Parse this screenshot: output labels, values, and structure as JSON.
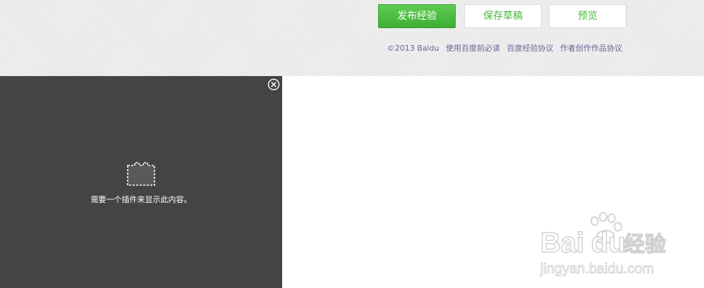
{
  "toolbar": {
    "publish_label": "发布经验",
    "save_draft_label": "保存草稿",
    "preview_label": "预览"
  },
  "footer": {
    "copyright": "©2013 Baidu",
    "links": [
      "使用百度前必读",
      "百度经验协议",
      "作者创作作品协议"
    ]
  },
  "plugin": {
    "message": "需要一个插件来显示此内容。",
    "close_icon": "close-circle-icon",
    "placeholder_icon": "plugin-placeholder-icon"
  },
  "watermark": {
    "brand": "Bai",
    "brand_suffix": "du",
    "product": "经验",
    "domain": "jingyan.baidu.com"
  },
  "colors": {
    "top_bg": "#ebebeb",
    "publish_green": "#4cbf41",
    "link_color": "#666699",
    "plugin_bg": "#444444"
  }
}
